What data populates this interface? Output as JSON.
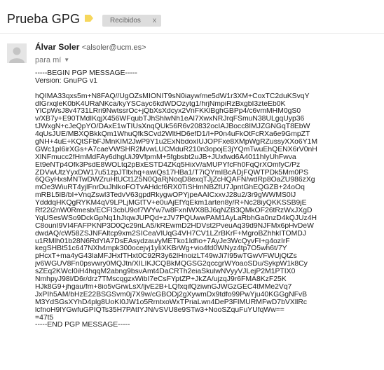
{
  "thread": {
    "subject": "Prueba GPG",
    "label": "Recibidos",
    "label_close": "x",
    "label_icon": "importance-marker-icon",
    "accent_color": "#f6d75c"
  },
  "message": {
    "sender_name": "Álvar Soler",
    "sender_email": "<alsoler@ucm.es>",
    "recipient": "para mí",
    "header_lines": [
      "-----BEGIN PGP MESSAGE-----",
      "Version: GnuPG v1"
    ],
    "body_lines": [
      "hQIMA33qxs5m+N8FAQ//UgOZsMIONIT9sN0iayw/me5dW1r3XM+CoxTC2duKSvqY",
      "dIGrxqleK0bK4URaNKca/kyYSCayc6kdWDOzytg1/hrjNmpiRzBxgbI3zteEb0K",
      "YlCpWsJ8v4731LRri9NwtssrOc+jQbXsXdcyx2VnFKKlBghGBPp4/c6vmMHM0gS0",
      "v/XB7y+E90TMdIKqjX456WFqubTJhShlwNh1eAl7XwxNRJrqFSmuN38ULgqUyp36",
      "tJWxgN+cJeQpYO/DAxE1wTIUsXnqQUk56R6v20832ocIAJBocc8IMJZGNGqT8EbW",
      "4qUsJUE/MBXQBkkQm1WhuQfkSCvd2WltHD6efD1/I+P0n4uFkOtFcRXa6e9GmpZT",
      "gNH+4uE+KQtSFbFJMnKIM2JwP9Y1u2ExNbdoxIUJOPFxe8XMpWgRZussyXXo6Y1M",
      "GWc1pI6irXGs+A7caeVWSHR2MvwLUCMduR210n3opojE3jYQmTwuEhQENX6rV0nH",
      "XlNFmucc2fHmMdFAy6dhgUiJ9VfpmM+5fgbsbt2uJB+JUxfwd6A4011hIyUhFwva",
      "Et9eNTp4Ofk3PsdE8WOLtq2pBxESTD4ZKq5HixV/aMUPYfcFh0FqQrXOmfyC/Pz",
      "ZDVwUtzYyxDW17u51zpJTltxhq+awiQs17HBa1/T7iQYmIBcADjFQWTPDk5Mm0PS",
      "6QGyHxsMNTwDWZruHtUCt1Z5N0QaRjNoqD8exqTJjZcHQAFN/wdRp8OaZU986zXg",
      "mOe3WiuRT4yjlFnrDuJhIkoFOTvAHdcf6RX0TiSHmNBZfU7JpntGhEQGZB+24oOq",
      "mRBL5lB/bI+VnqZswl3TedvV63gpdRkygwOPYjpeAAICxxvJ28u2/3r9gWWMS0lJ",
      "YdddqHKQgRYKM4qV9LPLjMGtTV+e0uAjEfYqEkm1arten8y/R+Nc28iyQKKSSB9jE",
      "Rf22i2nW0Rmesb/ECFI3cbU9of7WYw7w8FxnIWX8BJ6qNZB3QMkOF26tRzWxJXgD",
      "YqUSesWSo9DckGpNq1hJtqwJUPQd+zJV7PQUwwPAM1AyLaRbhGa0nzD4kQJUz4H",
      "C8ounI9VI4FAFPKNP3D0Qc29nLA5/kREwmD2HDVst2PveuAq39d9NJFMx6pHvDeW",
      "dwdAQ/cW58ZSJNFAltcp9xm2SICeaVlUqG4VH7CV1LZrBKrF+MgroBZhhkITOMDJ",
      "u1RMlh01b28N6RdYlA7DsEAsydzau/yMETko1Idfio+7AyJe3WcQyvFI+g4ozIrF",
      "kegSHBt51c647NXh4mpk300ocejvj1yIiXKBrWg+vio4fd0WNyz4tp7O5wh6t/7Y",
      "pHcxT+ma4yG43laMFJHxfTHxt0C92R3y62lHnoizLT49wJi7I95wTGwVFWUjQtZs",
      "jv6WGUV8Fn0psvwry0MQJtn/XILIKJCQBkMQGSG2qccgrWYoaoSDu/SykpW1k8Cy",
      "sZEq2KWcI0iH4hqqM2abng9bsvAmt4DaCRTh2eiaSkulwNVyyVJLejP2M1PTIX0",
      "NmhpyJ98I/D6r/drz7TMscqgzxWibI7eCsFYptZP+JkZA/ujzqJ9r6FMA8KzF25K",
      "HJk8G9+jhgau/fm+8io5vGrwLsX/ljvE2B+LQfxqifQziwnGJWGzGEC4tMMe2Vq7",
      "JxPIh5AM/bHzE22BSGSvm0j7X9w/cGBODj2gXywmDx9tdfo99PwYju40KGGgNFvB",
      "M3YdSGsXYhD4plg8UoKI0JW1o5RrntxoWxTPriaLwn4DeP3FIMURMFwD7bVXllRc",
      "lcfnoH9lYGwfuGPIQTs35H7PAtIYJN/vSVU8e9STw3+NooSZquFuYUfqWw==",
      "=47t5",
      "-----END PGP MESSAGE-----"
    ]
  }
}
